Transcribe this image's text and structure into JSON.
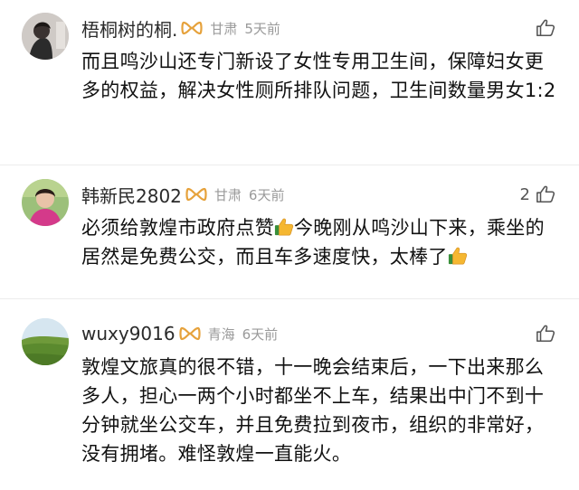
{
  "colors": {
    "badge": "#e6a23c",
    "meta_text": "#9a9a9a",
    "thumb_emoji": "#f5b731"
  },
  "comments": [
    {
      "username": "梧桐树的桐.",
      "region": "甘肃",
      "time": "5天前",
      "likes": "",
      "text": "而且鸣沙山还专门新设了女性专用卫生间，保障妇女更多的权益，解决女性厕所排队问题，卫生间数量男女1:2"
    },
    {
      "username": "韩新民2802",
      "region": "甘肃",
      "time": "6天前",
      "likes": "2",
      "text_part1": "必须给敦煌市政府点赞",
      "text_part2": "今晚刚从鸣沙山下来，乘坐的居然是免费公交，而且车多速度快，太棒了"
    },
    {
      "username": "wuxy9016",
      "region": "青海",
      "time": "6天前",
      "likes": "",
      "text": "敦煌文旅真的很不错，十一晚会结束后，一下出来那么多人，担心一两个小时都坐不上车，结果出中门不到十分钟就坐公交车，并且免费拉到夜市，组织的非常好，没有拥堵。难怪敦煌一直能火。"
    }
  ]
}
